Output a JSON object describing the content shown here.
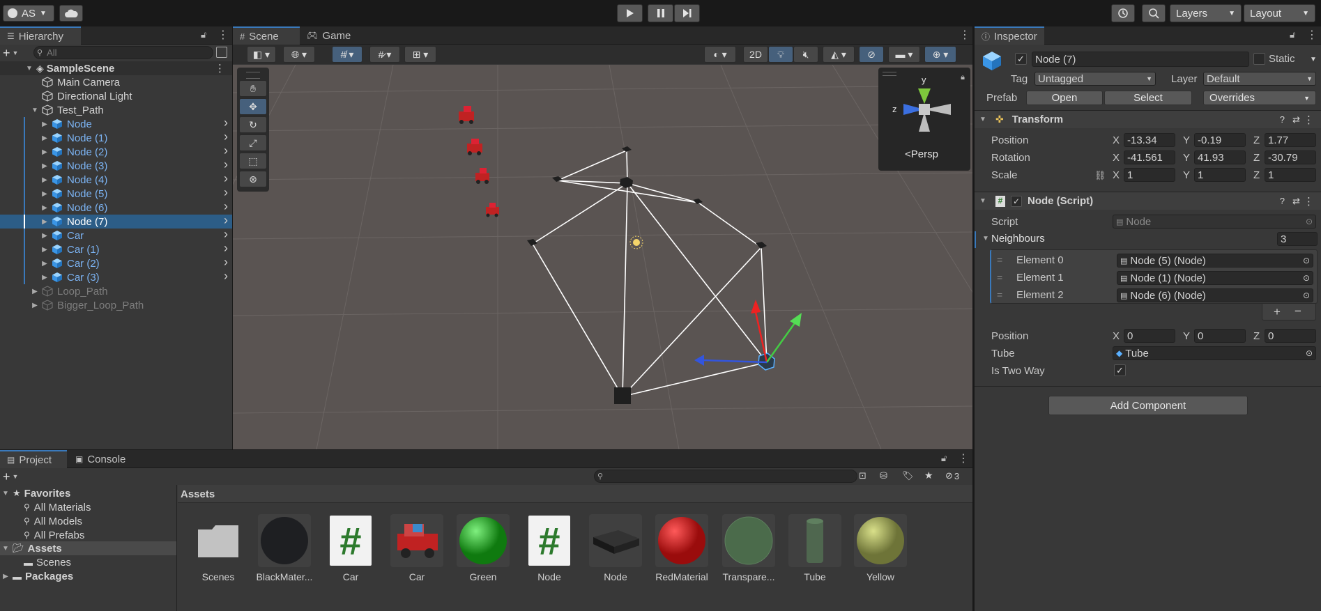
{
  "toolbar": {
    "account": "AS",
    "layers": "Layers",
    "layout": "Layout"
  },
  "hierarchy": {
    "tab": "Hierarchy",
    "search_placeholder": "All",
    "scene": "SampleScene",
    "items": [
      {
        "label": "Main Camera"
      },
      {
        "label": "Directional Light"
      },
      {
        "label": "Test_Path"
      },
      {
        "label": "Node"
      },
      {
        "label": "Node (1)"
      },
      {
        "label": "Node (2)"
      },
      {
        "label": "Node (3)"
      },
      {
        "label": "Node (4)"
      },
      {
        "label": "Node (5)"
      },
      {
        "label": "Node (6)"
      },
      {
        "label": "Node (7)"
      },
      {
        "label": "Car"
      },
      {
        "label": "Car (1)"
      },
      {
        "label": "Car (2)"
      },
      {
        "label": "Car (3)"
      },
      {
        "label": "Loop_Path"
      },
      {
        "label": "Bigger_Loop_Path"
      }
    ]
  },
  "scene": {
    "tab_scene": "Scene",
    "tab_game": "Game",
    "btn_2d": "2D",
    "gizmo_y": "y",
    "gizmo_z": "z",
    "persp": "Persp"
  },
  "inspector": {
    "tab": "Inspector",
    "object_name": "Node (7)",
    "static_label": "Static",
    "tag_label": "Tag",
    "tag_value": "Untagged",
    "layer_label": "Layer",
    "layer_value": "Default",
    "prefab_label": "Prefab",
    "open": "Open",
    "select": "Select",
    "overrides": "Overrides",
    "transform": {
      "title": "Transform",
      "position": {
        "label": "Position",
        "x": "-13.34",
        "y": "-0.19",
        "z": "1.77"
      },
      "rotation": {
        "label": "Rotation",
        "x": "-41.561",
        "y": "41.93",
        "z": "-30.79"
      },
      "scale": {
        "label": "Scale",
        "x": "1",
        "y": "1",
        "z": "1"
      }
    },
    "script_comp": {
      "title": "Node (Script)",
      "script_label": "Script",
      "script_value": "Node",
      "neighbors_label": "Neighbours",
      "neighbors_count": "3",
      "elements": [
        {
          "label": "Element 0",
          "value": "Node (5) (Node)"
        },
        {
          "label": "Element 1",
          "value": "Node (1) (Node)"
        },
        {
          "label": "Element 2",
          "value": "Node (6) (Node)"
        }
      ],
      "plus": "+",
      "minus": "−",
      "position": {
        "label": "Position",
        "x": "0",
        "y": "0",
        "z": "0"
      },
      "tube_label": "Tube",
      "tube_value": "Tube",
      "two_way_label": "Is Two Way"
    },
    "add_component": "Add Component",
    "axis": {
      "x": "X",
      "y": "Y",
      "z": "Z"
    }
  },
  "project": {
    "tab_project": "Project",
    "tab_console": "Console",
    "hidden_count": "3",
    "favorites": "Favorites",
    "fav_items": [
      {
        "label": "All Materials"
      },
      {
        "label": "All Models"
      },
      {
        "label": "All Prefabs"
      }
    ],
    "assets_root": "Assets",
    "scenes": "Scenes",
    "packages": "Packages",
    "assets_header": "Assets",
    "assets": [
      {
        "name": "Scenes"
      },
      {
        "name": "BlackMater..."
      },
      {
        "name": "Car"
      },
      {
        "name": "Car"
      },
      {
        "name": "Green"
      },
      {
        "name": "Node"
      },
      {
        "name": "Node"
      },
      {
        "name": "RedMaterial"
      },
      {
        "name": "Transpare..."
      },
      {
        "name": "Tube"
      },
      {
        "name": "Yellow"
      }
    ]
  }
}
